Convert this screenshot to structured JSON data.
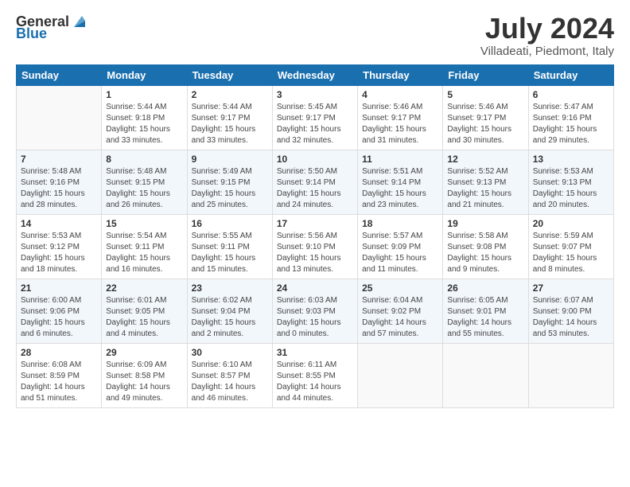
{
  "logo": {
    "general": "General",
    "blue": "Blue"
  },
  "title": "July 2024",
  "subtitle": "Villadeati, Piedmont, Italy",
  "header_days": [
    "Sunday",
    "Monday",
    "Tuesday",
    "Wednesday",
    "Thursday",
    "Friday",
    "Saturday"
  ],
  "weeks": [
    [
      {
        "day": "",
        "empty": true
      },
      {
        "day": "1",
        "sunrise": "5:44 AM",
        "sunset": "9:18 PM",
        "daylight": "15 hours and 33 minutes."
      },
      {
        "day": "2",
        "sunrise": "5:44 AM",
        "sunset": "9:17 PM",
        "daylight": "15 hours and 33 minutes."
      },
      {
        "day": "3",
        "sunrise": "5:45 AM",
        "sunset": "9:17 PM",
        "daylight": "15 hours and 32 minutes."
      },
      {
        "day": "4",
        "sunrise": "5:46 AM",
        "sunset": "9:17 PM",
        "daylight": "15 hours and 31 minutes."
      },
      {
        "day": "5",
        "sunrise": "5:46 AM",
        "sunset": "9:17 PM",
        "daylight": "15 hours and 30 minutes."
      },
      {
        "day": "6",
        "sunrise": "5:47 AM",
        "sunset": "9:16 PM",
        "daylight": "15 hours and 29 minutes."
      }
    ],
    [
      {
        "day": "7",
        "sunrise": "5:48 AM",
        "sunset": "9:16 PM",
        "daylight": "15 hours and 28 minutes."
      },
      {
        "day": "8",
        "sunrise": "5:48 AM",
        "sunset": "9:15 PM",
        "daylight": "15 hours and 26 minutes."
      },
      {
        "day": "9",
        "sunrise": "5:49 AM",
        "sunset": "9:15 PM",
        "daylight": "15 hours and 25 minutes."
      },
      {
        "day": "10",
        "sunrise": "5:50 AM",
        "sunset": "9:14 PM",
        "daylight": "15 hours and 24 minutes."
      },
      {
        "day": "11",
        "sunrise": "5:51 AM",
        "sunset": "9:14 PM",
        "daylight": "15 hours and 23 minutes."
      },
      {
        "day": "12",
        "sunrise": "5:52 AM",
        "sunset": "9:13 PM",
        "daylight": "15 hours and 21 minutes."
      },
      {
        "day": "13",
        "sunrise": "5:53 AM",
        "sunset": "9:13 PM",
        "daylight": "15 hours and 20 minutes."
      }
    ],
    [
      {
        "day": "14",
        "sunrise": "5:53 AM",
        "sunset": "9:12 PM",
        "daylight": "15 hours and 18 minutes."
      },
      {
        "day": "15",
        "sunrise": "5:54 AM",
        "sunset": "9:11 PM",
        "daylight": "15 hours and 16 minutes."
      },
      {
        "day": "16",
        "sunrise": "5:55 AM",
        "sunset": "9:11 PM",
        "daylight": "15 hours and 15 minutes."
      },
      {
        "day": "17",
        "sunrise": "5:56 AM",
        "sunset": "9:10 PM",
        "daylight": "15 hours and 13 minutes."
      },
      {
        "day": "18",
        "sunrise": "5:57 AM",
        "sunset": "9:09 PM",
        "daylight": "15 hours and 11 minutes."
      },
      {
        "day": "19",
        "sunrise": "5:58 AM",
        "sunset": "9:08 PM",
        "daylight": "15 hours and 9 minutes."
      },
      {
        "day": "20",
        "sunrise": "5:59 AM",
        "sunset": "9:07 PM",
        "daylight": "15 hours and 8 minutes."
      }
    ],
    [
      {
        "day": "21",
        "sunrise": "6:00 AM",
        "sunset": "9:06 PM",
        "daylight": "15 hours and 6 minutes."
      },
      {
        "day": "22",
        "sunrise": "6:01 AM",
        "sunset": "9:05 PM",
        "daylight": "15 hours and 4 minutes."
      },
      {
        "day": "23",
        "sunrise": "6:02 AM",
        "sunset": "9:04 PM",
        "daylight": "15 hours and 2 minutes."
      },
      {
        "day": "24",
        "sunrise": "6:03 AM",
        "sunset": "9:03 PM",
        "daylight": "15 hours and 0 minutes."
      },
      {
        "day": "25",
        "sunrise": "6:04 AM",
        "sunset": "9:02 PM",
        "daylight": "14 hours and 57 minutes."
      },
      {
        "day": "26",
        "sunrise": "6:05 AM",
        "sunset": "9:01 PM",
        "daylight": "14 hours and 55 minutes."
      },
      {
        "day": "27",
        "sunrise": "6:07 AM",
        "sunset": "9:00 PM",
        "daylight": "14 hours and 53 minutes."
      }
    ],
    [
      {
        "day": "28",
        "sunrise": "6:08 AM",
        "sunset": "8:59 PM",
        "daylight": "14 hours and 51 minutes."
      },
      {
        "day": "29",
        "sunrise": "6:09 AM",
        "sunset": "8:58 PM",
        "daylight": "14 hours and 49 minutes."
      },
      {
        "day": "30",
        "sunrise": "6:10 AM",
        "sunset": "8:57 PM",
        "daylight": "14 hours and 46 minutes."
      },
      {
        "day": "31",
        "sunrise": "6:11 AM",
        "sunset": "8:55 PM",
        "daylight": "14 hours and 44 minutes."
      },
      {
        "day": "",
        "empty": true
      },
      {
        "day": "",
        "empty": true
      },
      {
        "day": "",
        "empty": true
      }
    ]
  ],
  "labels": {
    "sunrise": "Sunrise:",
    "sunset": "Sunset:",
    "daylight": "Daylight:"
  }
}
